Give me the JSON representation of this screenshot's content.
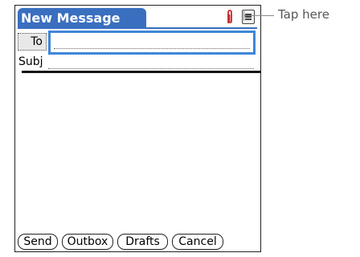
{
  "window": {
    "title": "New Message"
  },
  "form": {
    "to_label": "To",
    "to_value": "",
    "subj_label": "Subj",
    "subj_value": ""
  },
  "buttons": [
    "Send",
    "Outbox",
    "Drafts",
    "Cancel"
  ],
  "icons": {
    "attachment": "paperclip-icon",
    "menu": "menu-icon"
  },
  "callout": {
    "text": "Tap here"
  },
  "colors": {
    "title_bg": "#3a6fc0",
    "focus_border": "#3f86d8",
    "paperclip": "#c62828"
  }
}
